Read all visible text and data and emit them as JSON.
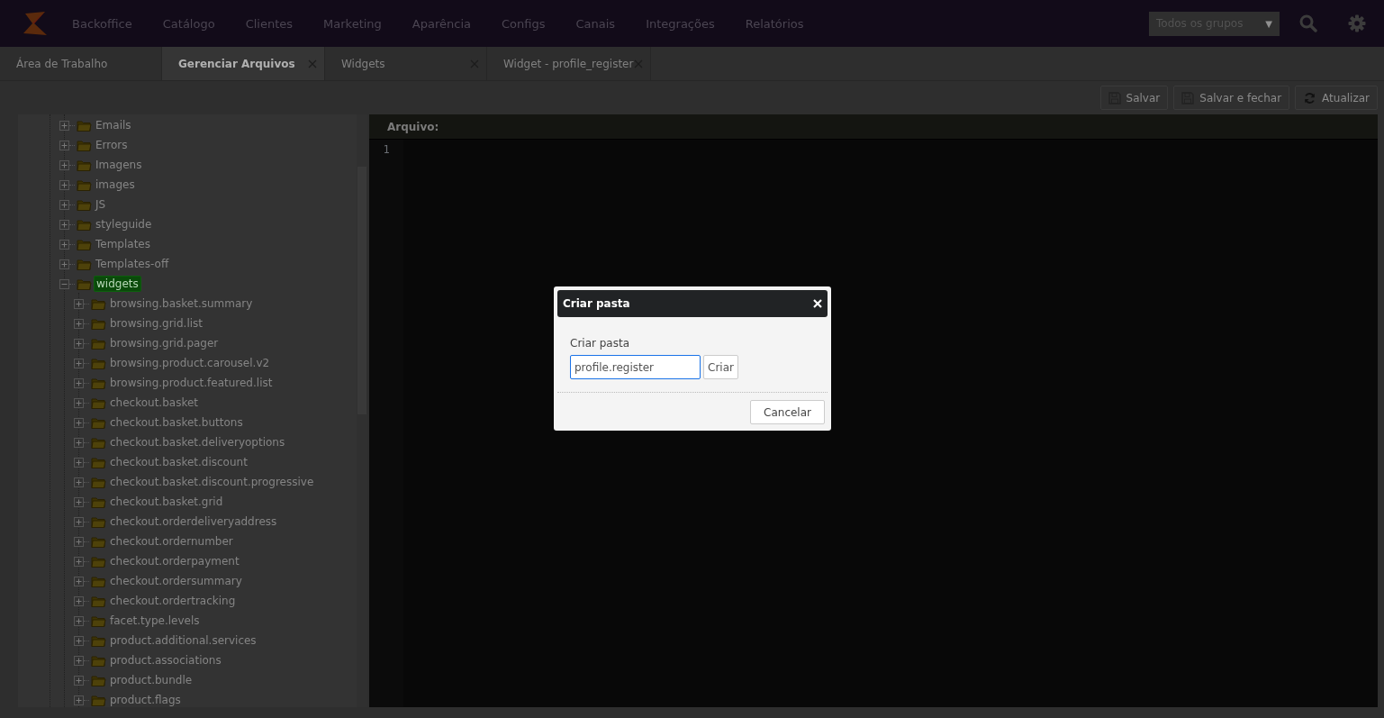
{
  "navbar": {
    "menu": [
      "Backoffice",
      "Catálogo",
      "Clientes",
      "Marketing",
      "Aparência",
      "Configs",
      "Canais",
      "Integrações",
      "Relatórios"
    ],
    "group_select": {
      "value": "Todos os grupos",
      "caret": "▼"
    }
  },
  "tabs": [
    {
      "label": "Área de Trabalho",
      "selected": false,
      "closable": false
    },
    {
      "label": "Gerenciar Arquivos",
      "selected": true,
      "closable": true
    },
    {
      "label": "Widgets",
      "selected": false,
      "closable": true
    },
    {
      "label": "Widget - profile_register",
      "selected": false,
      "closable": true
    }
  ],
  "toolbar": [
    {
      "label": "Salvar",
      "kind": "save"
    },
    {
      "label": "Salvar e fechar",
      "kind": "save"
    },
    {
      "label": "Atualizar",
      "kind": "refresh"
    }
  ],
  "tree": [
    {
      "label": "Emails",
      "expanded": false,
      "selected": false
    },
    {
      "label": "Errors",
      "expanded": false,
      "selected": false
    },
    {
      "label": "Imagens",
      "expanded": false,
      "selected": false
    },
    {
      "label": "images",
      "expanded": false,
      "selected": false
    },
    {
      "label": "JS",
      "expanded": false,
      "selected": false
    },
    {
      "label": "styleguide",
      "expanded": false,
      "selected": false
    },
    {
      "label": "Templates",
      "expanded": false,
      "selected": false
    },
    {
      "label": "Templates-off",
      "expanded": false,
      "selected": false
    },
    {
      "label": "widgets",
      "expanded": true,
      "selected": true,
      "children": [
        {
          "label": "browsing.basket.summary",
          "expanded": false,
          "selected": false
        },
        {
          "label": "browsing.grid.list",
          "expanded": false,
          "selected": false
        },
        {
          "label": "browsing.grid.pager",
          "expanded": false,
          "selected": false
        },
        {
          "label": "browsing.product.carousel.v2",
          "expanded": false,
          "selected": false
        },
        {
          "label": "browsing.product.featured.list",
          "expanded": false,
          "selected": false
        },
        {
          "label": "checkout.basket",
          "expanded": false,
          "selected": false
        },
        {
          "label": "checkout.basket.buttons",
          "expanded": false,
          "selected": false
        },
        {
          "label": "checkout.basket.deliveryoptions",
          "expanded": false,
          "selected": false
        },
        {
          "label": "checkout.basket.discount",
          "expanded": false,
          "selected": false
        },
        {
          "label": "checkout.basket.discount.progressive",
          "expanded": false,
          "selected": false
        },
        {
          "label": "checkout.basket.grid",
          "expanded": false,
          "selected": false
        },
        {
          "label": "checkout.orderdeliveryaddress",
          "expanded": false,
          "selected": false
        },
        {
          "label": "checkout.ordernumber",
          "expanded": false,
          "selected": false
        },
        {
          "label": "checkout.orderpayment",
          "expanded": false,
          "selected": false
        },
        {
          "label": "checkout.ordersummary",
          "expanded": false,
          "selected": false
        },
        {
          "label": "checkout.ordertracking",
          "expanded": false,
          "selected": false
        },
        {
          "label": "facet.type.levels",
          "expanded": false,
          "selected": false
        },
        {
          "label": "product.additional.services",
          "expanded": false,
          "selected": false
        },
        {
          "label": "product.associations",
          "expanded": false,
          "selected": false
        },
        {
          "label": "product.bundle",
          "expanded": false,
          "selected": false
        },
        {
          "label": "product.flags",
          "expanded": false,
          "selected": false
        }
      ]
    }
  ],
  "editor": {
    "header": "Arquivo:",
    "line_numbers": [
      "1"
    ]
  },
  "dialog": {
    "title": "Criar pasta",
    "field_label": "Criar pasta",
    "field_value": "profile.register",
    "create_button": "Criar",
    "cancel_button": "Cancelar"
  }
}
